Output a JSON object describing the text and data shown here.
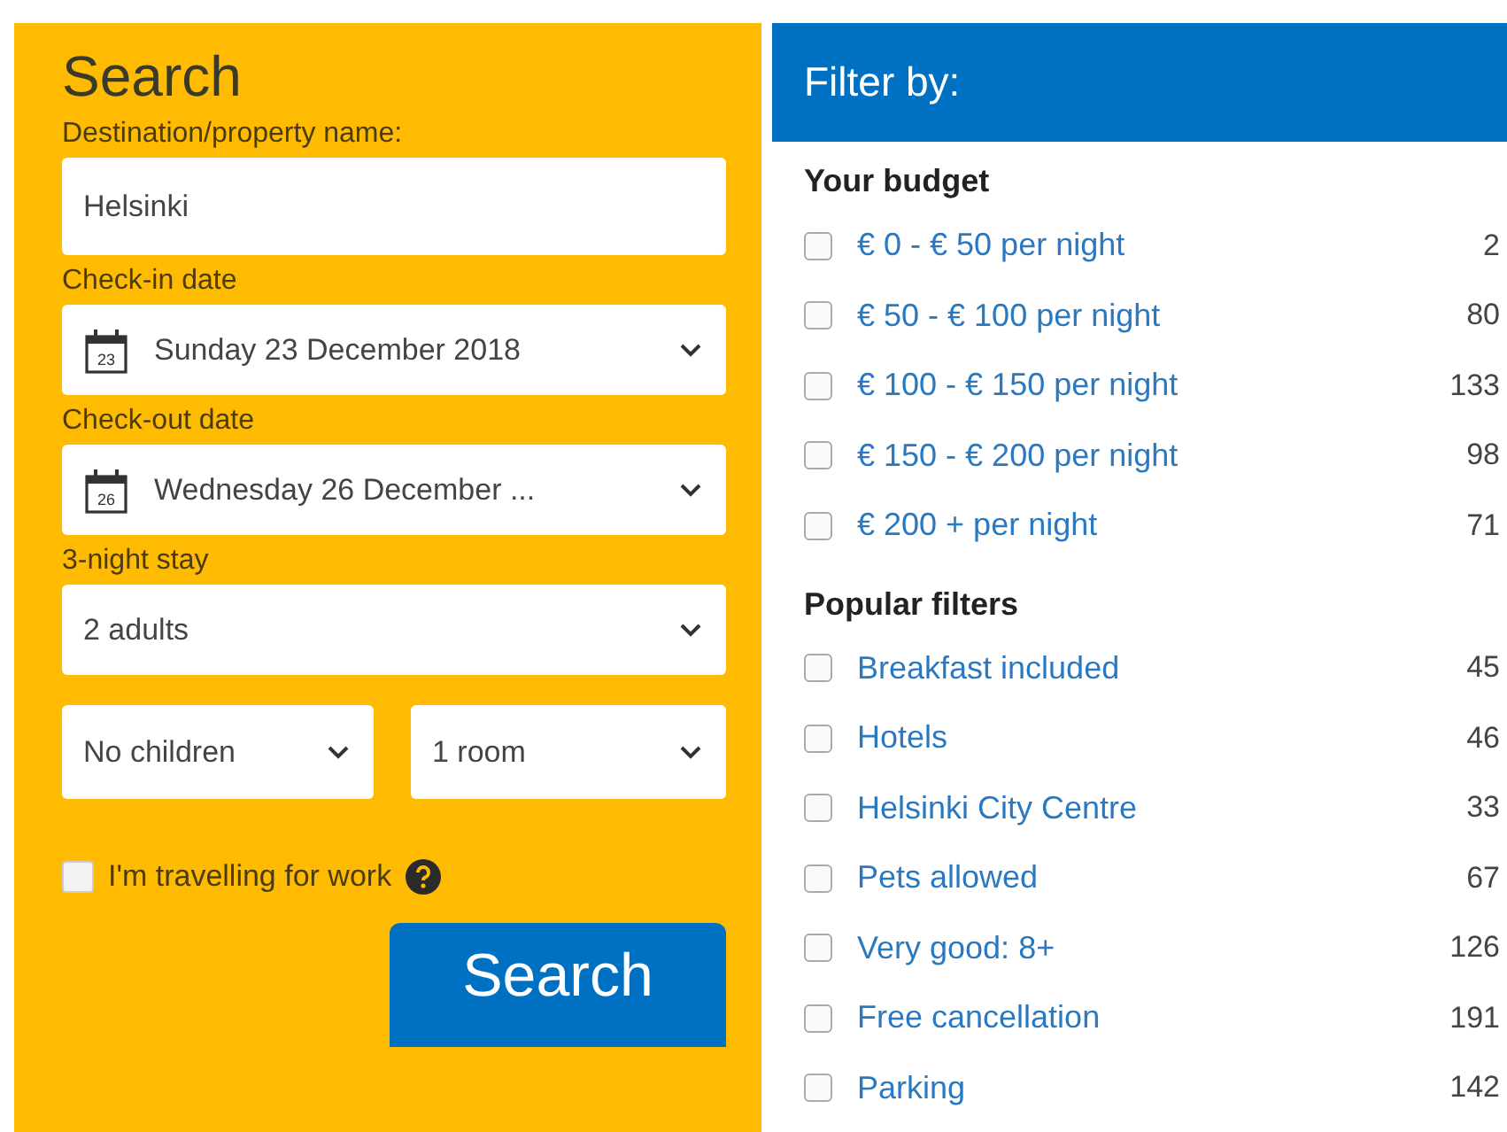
{
  "search": {
    "title": "Search",
    "destination": {
      "label": "Destination/property name:",
      "value": "Helsinki"
    },
    "checkin": {
      "label": "Check-in date",
      "calendar_day": "23",
      "value": "Sunday 23 December 2018"
    },
    "checkout": {
      "label": "Check-out date",
      "calendar_day": "26",
      "value": "Wednesday 26 December ..."
    },
    "stay_label": "3-night stay",
    "adults": "2 adults",
    "children": "No children",
    "rooms": "1 room",
    "work": {
      "label": "I'm travelling for work",
      "checked": false
    },
    "button": "Search"
  },
  "filter": {
    "title": "Filter by:",
    "sections": [
      {
        "heading": "Your budget",
        "options": [
          {
            "label": "€ 0 - € 50 per night",
            "count": "2",
            "checked": false
          },
          {
            "label": "€ 50 - € 100 per night",
            "count": "80",
            "checked": false
          },
          {
            "label": "€ 100 - € 150 per night",
            "count": "133",
            "checked": false
          },
          {
            "label": "€ 150 - € 200 per night",
            "count": "98",
            "checked": false
          },
          {
            "label": "€ 200 + per night",
            "count": "71",
            "checked": false
          }
        ]
      },
      {
        "heading": "Popular filters",
        "options": [
          {
            "label": "Breakfast included",
            "count": "45",
            "checked": false
          },
          {
            "label": "Hotels",
            "count": "46",
            "checked": false
          },
          {
            "label": "Helsinki City Centre",
            "count": "33",
            "checked": false
          },
          {
            "label": "Pets allowed",
            "count": "67",
            "checked": false
          },
          {
            "label": "Very good: 8+",
            "count": "126",
            "checked": false
          },
          {
            "label": "Free cancellation",
            "count": "191",
            "checked": false
          },
          {
            "label": "Parking",
            "count": "142",
            "checked": false
          }
        ]
      }
    ]
  }
}
